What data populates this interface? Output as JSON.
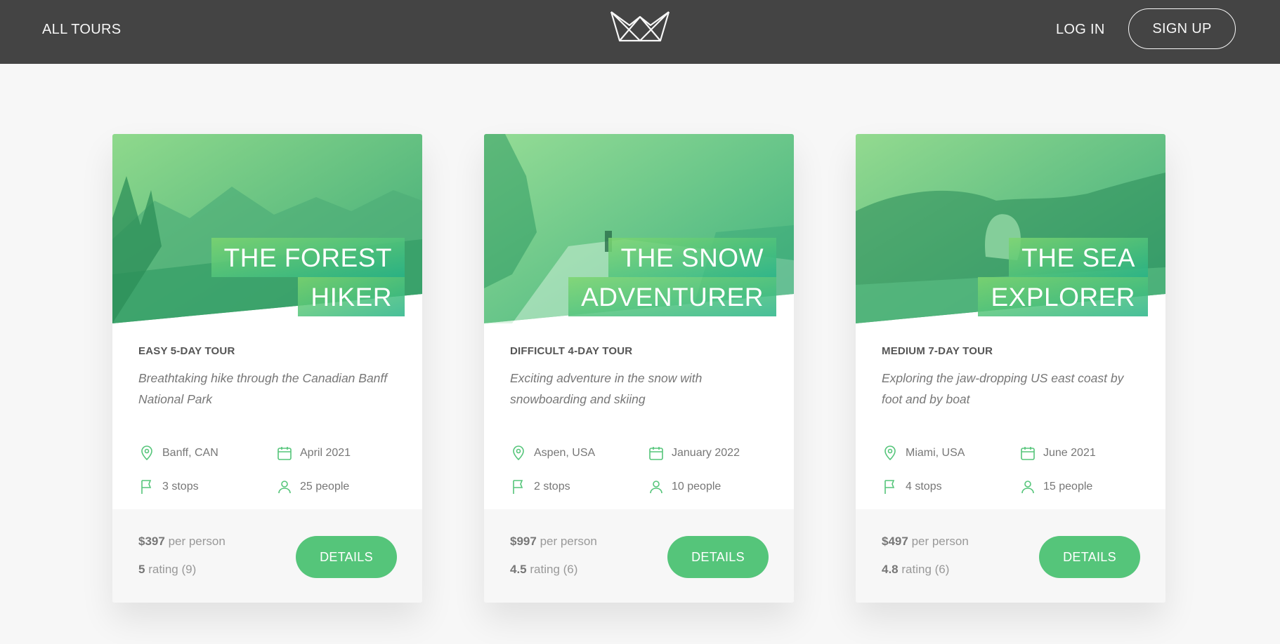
{
  "header": {
    "all_tours": "ALL TOURS",
    "logo_icon": "crown-logo-icon",
    "login": "LOG IN",
    "signup": "SIGN UP"
  },
  "colors": {
    "header_bg": "#444444",
    "page_bg": "#f7f7f7",
    "accent": "#55c57a",
    "accent_dark": "#28b487"
  },
  "icons": {
    "location": "map-pin-icon",
    "date": "calendar-icon",
    "stops": "flag-icon",
    "people": "user-icon"
  },
  "tours": [
    {
      "title_line1": "THE FOREST",
      "title_line2": "HIKER",
      "subheading": "EASY 5-DAY TOUR",
      "summary": "Breathtaking hike through the Canadian Banff National Park",
      "location": "Banff, CAN",
      "date": "April 2021",
      "stops": "3 stops",
      "people": "25 people",
      "price": "$397",
      "price_label": "per person",
      "rating": "5",
      "rating_label": "rating (9)",
      "button": "DETAILS"
    },
    {
      "title_line1": "THE SNOW",
      "title_line2": "ADVENTURER",
      "subheading": "DIFFICULT 4-DAY TOUR",
      "summary": "Exciting adventure in the snow with snowboarding and skiing",
      "location": "Aspen, USA",
      "date": "January 2022",
      "stops": "2 stops",
      "people": "10 people",
      "price": "$997",
      "price_label": "per person",
      "rating": "4.5",
      "rating_label": "rating (6)",
      "button": "DETAILS"
    },
    {
      "title_line1": "THE SEA",
      "title_line2": "EXPLORER",
      "subheading": "MEDIUM 7-DAY TOUR",
      "summary": "Exploring the jaw-dropping US east coast by foot and by boat",
      "location": "Miami, USA",
      "date": "June 2021",
      "stops": "4 stops",
      "people": "15 people",
      "price": "$497",
      "price_label": "per person",
      "rating": "4.8",
      "rating_label": "rating (6)",
      "button": "DETAILS"
    }
  ]
}
